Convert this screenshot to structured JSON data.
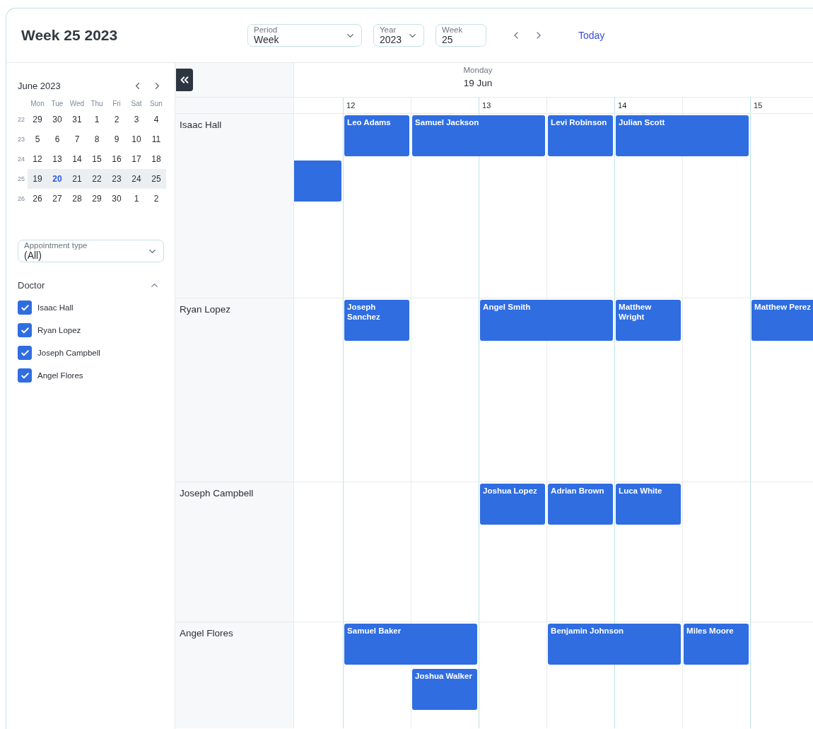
{
  "title": "Week 25 2023",
  "toolbar": {
    "period": {
      "label": "Period",
      "value": "Week"
    },
    "year": {
      "label": "Year",
      "value": "2023"
    },
    "week": {
      "label": "Week",
      "value": "25"
    },
    "today_button": "Today"
  },
  "mini_calendar": {
    "month": "June 2023",
    "weekdays": [
      "Mon",
      "Tue",
      "Wed",
      "Thu",
      "Fri",
      "Sat",
      "Sun"
    ],
    "weeks": [
      {
        "number": "22",
        "selected": false,
        "days": [
          {
            "label": "29",
            "today": false
          },
          {
            "label": "30",
            "today": false
          },
          {
            "label": "31",
            "today": false
          },
          {
            "label": "1",
            "today": false
          },
          {
            "label": "2",
            "today": false
          },
          {
            "label": "3",
            "today": false
          },
          {
            "label": "4",
            "today": false
          }
        ]
      },
      {
        "number": "23",
        "selected": false,
        "days": [
          {
            "label": "5",
            "today": false
          },
          {
            "label": "6",
            "today": false
          },
          {
            "label": "7",
            "today": false
          },
          {
            "label": "8",
            "today": false
          },
          {
            "label": "9",
            "today": false
          },
          {
            "label": "10",
            "today": false
          },
          {
            "label": "11",
            "today": false
          }
        ]
      },
      {
        "number": "24",
        "selected": false,
        "days": [
          {
            "label": "12",
            "today": false
          },
          {
            "label": "13",
            "today": false
          },
          {
            "label": "14",
            "today": false
          },
          {
            "label": "15",
            "today": false
          },
          {
            "label": "16",
            "today": false
          },
          {
            "label": "17",
            "today": false
          },
          {
            "label": "18",
            "today": false
          }
        ]
      },
      {
        "number": "25",
        "selected": true,
        "days": [
          {
            "label": "19",
            "today": false
          },
          {
            "label": "20",
            "today": true
          },
          {
            "label": "21",
            "today": false
          },
          {
            "label": "22",
            "today": false
          },
          {
            "label": "23",
            "today": false
          },
          {
            "label": "24",
            "today": false
          },
          {
            "label": "25",
            "today": false
          }
        ]
      },
      {
        "number": "26",
        "selected": false,
        "days": [
          {
            "label": "26",
            "today": false
          },
          {
            "label": "27",
            "today": false
          },
          {
            "label": "28",
            "today": false
          },
          {
            "label": "29",
            "today": false
          },
          {
            "label": "30",
            "today": false
          },
          {
            "label": "1",
            "today": false
          },
          {
            "label": "2",
            "today": false
          }
        ]
      }
    ]
  },
  "appointment_type": {
    "label": "Appointment type",
    "value": "(All)"
  },
  "doctor_filter": {
    "title": "Doctor",
    "expanded": true,
    "items": [
      {
        "label": "Isaac Hall",
        "checked": true
      },
      {
        "label": "Ryan Lopez",
        "checked": true
      },
      {
        "label": "Joseph Campbell",
        "checked": true
      },
      {
        "label": "Angel Flores",
        "checked": true
      }
    ]
  },
  "scheduler": {
    "day": {
      "weekday": "Monday",
      "date": "19 Jun"
    },
    "hours": [
      "12",
      "13",
      "14",
      "15"
    ],
    "resources": [
      {
        "name": "Isaac Hall",
        "events": [
          {
            "kind": "continuation"
          },
          {
            "kind": "appointment",
            "title": "Leo Adams"
          },
          {
            "kind": "appointment",
            "title": "Samuel Jackson"
          },
          {
            "kind": "appointment",
            "title": "Levi Robinson"
          },
          {
            "kind": "appointment",
            "title": "Julian Scott"
          }
        ]
      },
      {
        "name": "Ryan Lopez",
        "events": [
          {
            "kind": "appointment",
            "title": "Joseph Sanchez"
          },
          {
            "kind": "appointment",
            "title": "Angel Smith"
          },
          {
            "kind": "appointment",
            "title": "Matthew Wright"
          },
          {
            "kind": "appointment",
            "title": "Matthew Perez"
          }
        ]
      },
      {
        "name": "Joseph Campbell",
        "events": [
          {
            "kind": "appointment",
            "title": "Joshua Lopez"
          },
          {
            "kind": "appointment",
            "title": "Adrian Brown"
          },
          {
            "kind": "appointment",
            "title": "Luca White"
          }
        ]
      },
      {
        "name": "Angel Flores",
        "events": [
          {
            "kind": "appointment",
            "title": "Samuel Baker"
          },
          {
            "kind": "appointment",
            "title": "Joshua Walker"
          },
          {
            "kind": "appointment",
            "title": "Benjamin Johnson"
          },
          {
            "kind": "appointment",
            "title": "Miles Moore"
          }
        ]
      }
    ]
  }
}
